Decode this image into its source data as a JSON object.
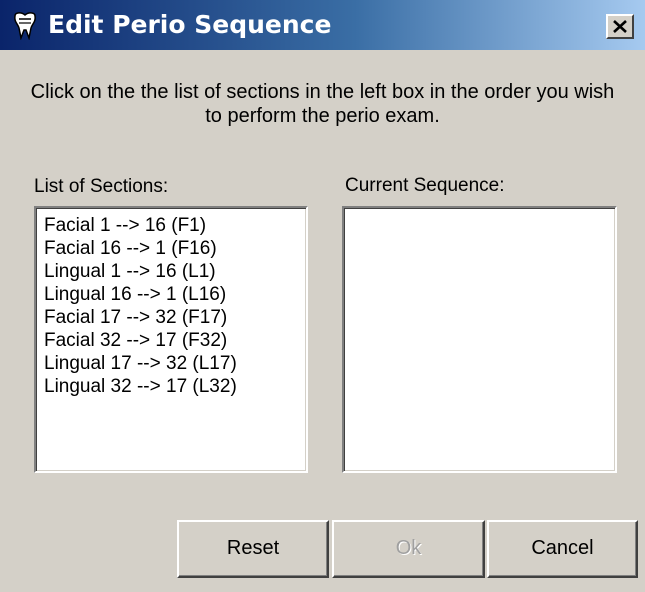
{
  "window": {
    "title": "Edit Perio Sequence",
    "icon": "tooth-app-icon",
    "close_icon": "close-icon"
  },
  "instructions": "Click on the the list of sections in the left box in the order you wish to perform the perio exam.",
  "sections": {
    "label": "List of Sections:",
    "items": [
      "Facial 1 --> 16 (F1)",
      "Facial 16 --> 1 (F16)",
      "Lingual 1 --> 16 (L1)",
      "Lingual 16 --> 1 (L16)",
      "Facial 17 --> 32 (F17)",
      "Facial 32 --> 17 (F32)",
      "Lingual 17 --> 32 (L17)",
      "Lingual 32 --> 17 (L32)"
    ]
  },
  "sequence": {
    "label": "Current Sequence:",
    "items": []
  },
  "buttons": {
    "reset": "Reset",
    "ok": "Ok",
    "ok_enabled": false,
    "cancel": "Cancel"
  },
  "colors": {
    "window_bg": "#d4d0c8",
    "titlebar_start": "#0a246a",
    "titlebar_end": "#a6caf0",
    "disabled_text": "#a0a0a0"
  }
}
